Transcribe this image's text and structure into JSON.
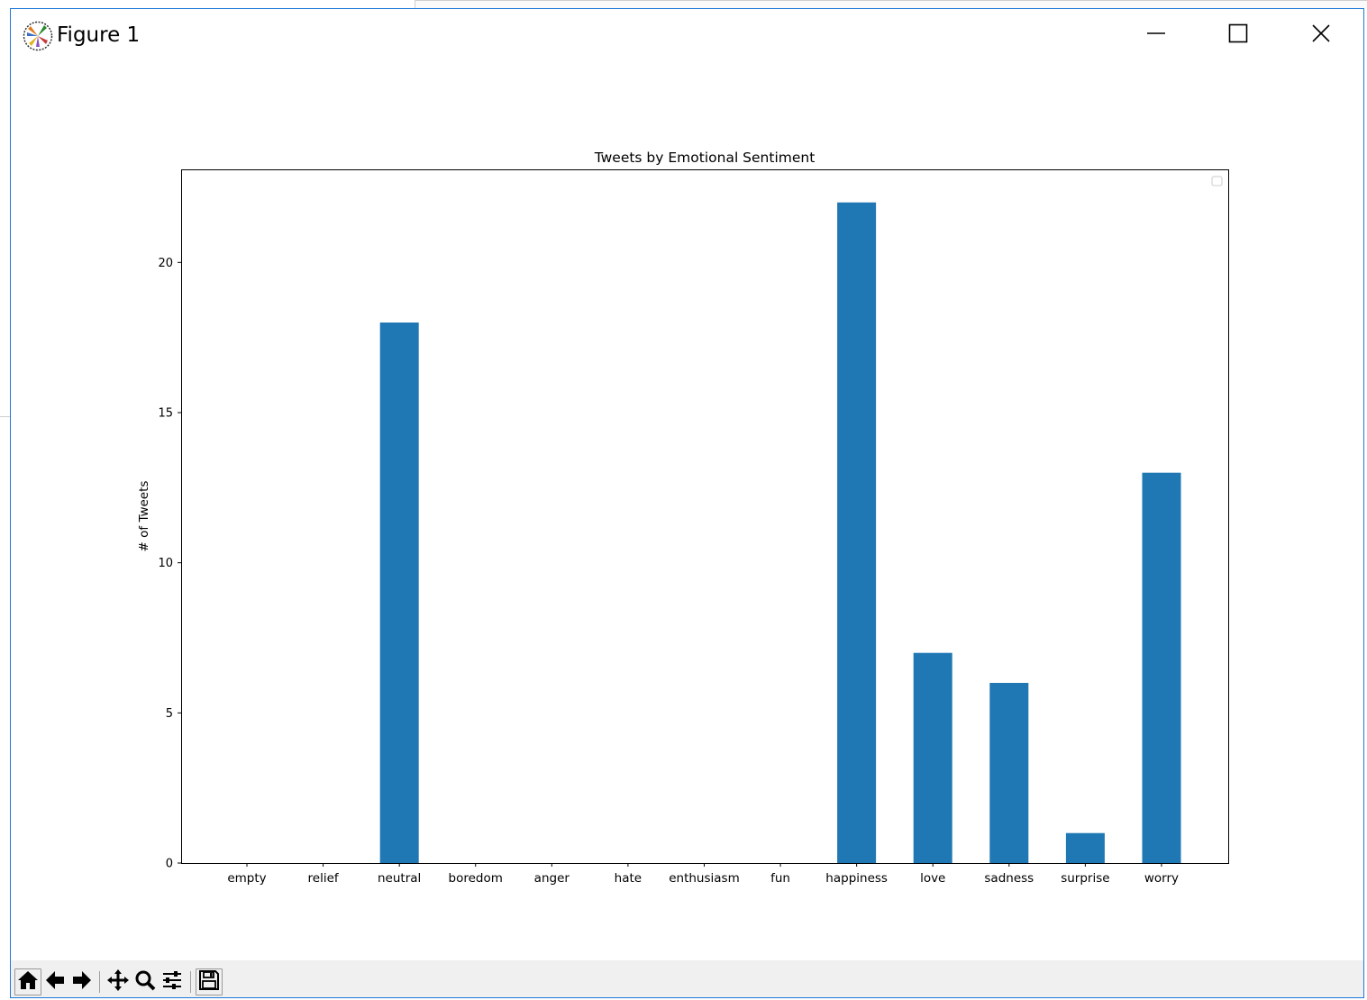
{
  "window": {
    "title": "Figure 1",
    "icon": "matplotlib-logo-icon",
    "controls": [
      "minimize-icon",
      "maximize-icon",
      "close-icon"
    ]
  },
  "toolbar": {
    "tools": [
      "home-icon",
      "back-arrow-icon",
      "forward-arrow-icon",
      "pan-move-icon",
      "zoom-magnifier-icon",
      "configure-subplots-icon",
      "save-floppy-icon"
    ]
  },
  "chart_data": {
    "type": "bar",
    "title": "Tweets by Emotional Sentiment",
    "xlabel": "",
    "ylabel": "# of Tweets",
    "categories": [
      "empty",
      "relief",
      "neutral",
      "boredom",
      "anger",
      "hate",
      "enthusiasm",
      "fun",
      "happiness",
      "love",
      "sadness",
      "surprise",
      "worry"
    ],
    "values": [
      0,
      0,
      18,
      0,
      0,
      0,
      0,
      0,
      22,
      7,
      6,
      1,
      13
    ],
    "ylim": [
      0,
      23.1
    ],
    "yticks": [
      0,
      5,
      10,
      15,
      20
    ],
    "bar_color": "#1f77b4",
    "grid": false,
    "legend": "top-right (empty)"
  }
}
